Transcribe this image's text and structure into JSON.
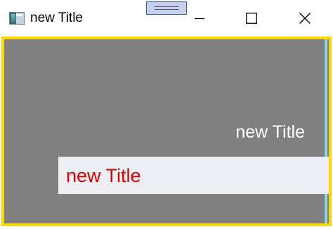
{
  "window": {
    "title": "new Title",
    "icon": "app-window-icon",
    "controls": {
      "minimize": "minimize-icon",
      "maximize": "maximize-icon",
      "close": "close-icon"
    }
  },
  "content": {
    "label": "new Title",
    "textbox_value": "new Title"
  },
  "colors": {
    "frame_border": "#ffd600",
    "content_background": "#808080",
    "label_text": "#ffffff",
    "textbox_text": "#e00000",
    "textbox_background": "#eeeff5",
    "drag_handle": "#c6d0ea"
  }
}
